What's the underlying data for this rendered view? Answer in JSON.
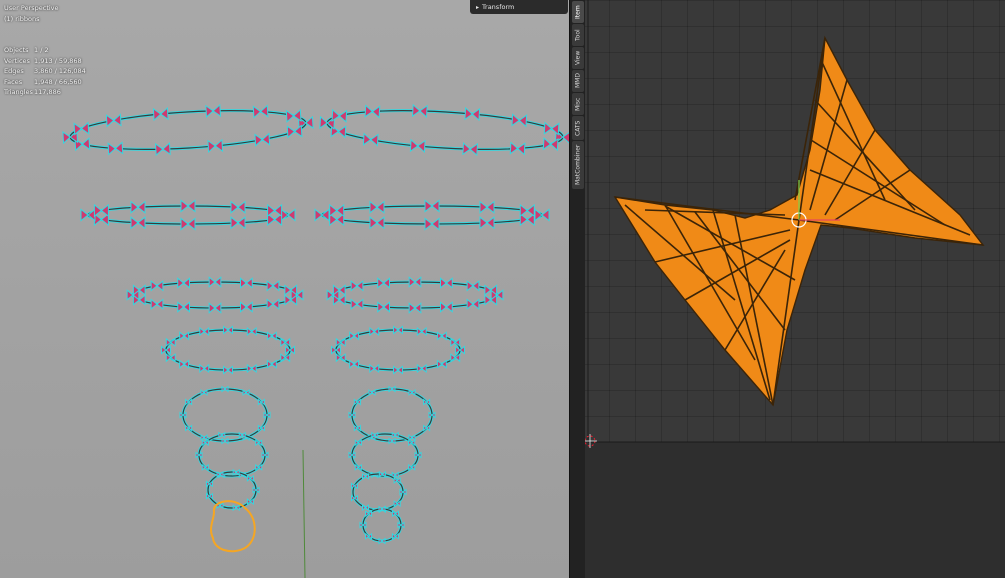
{
  "viewport": {
    "perspective": "User Perspective",
    "object_name": "(1) ribbons",
    "stats": [
      {
        "label": "Objects",
        "value": "1 / 2"
      },
      {
        "label": "Vertices",
        "value": "1,913 / 59,868"
      },
      {
        "label": "Edges",
        "value": "3,860 / 126,084"
      },
      {
        "label": "Faces",
        "value": "1,948 / 66,560"
      },
      {
        "label": "Triangles",
        "value": "117,886"
      }
    ]
  },
  "sidebar": {
    "panel_title": "Transform",
    "tabs": [
      "Item",
      "Tool",
      "View",
      "MMD",
      "Misc",
      "CATS",
      "MatCombiner"
    ],
    "active_tab": "Item"
  },
  "colors": {
    "viewport_bg": "#a3a3a3",
    "wire": "#35d7e0",
    "ribbon": "#cf3a6f",
    "selected": "#f5a623",
    "uv_fill": "#f08a17",
    "uv_edge": "#3b2408",
    "uv_bg": "#393939"
  },
  "icons": {
    "panel_toggle": "chevron-right-icon",
    "cursor": "3d-cursor-icon",
    "pivot": "pivot-circle-icon"
  }
}
